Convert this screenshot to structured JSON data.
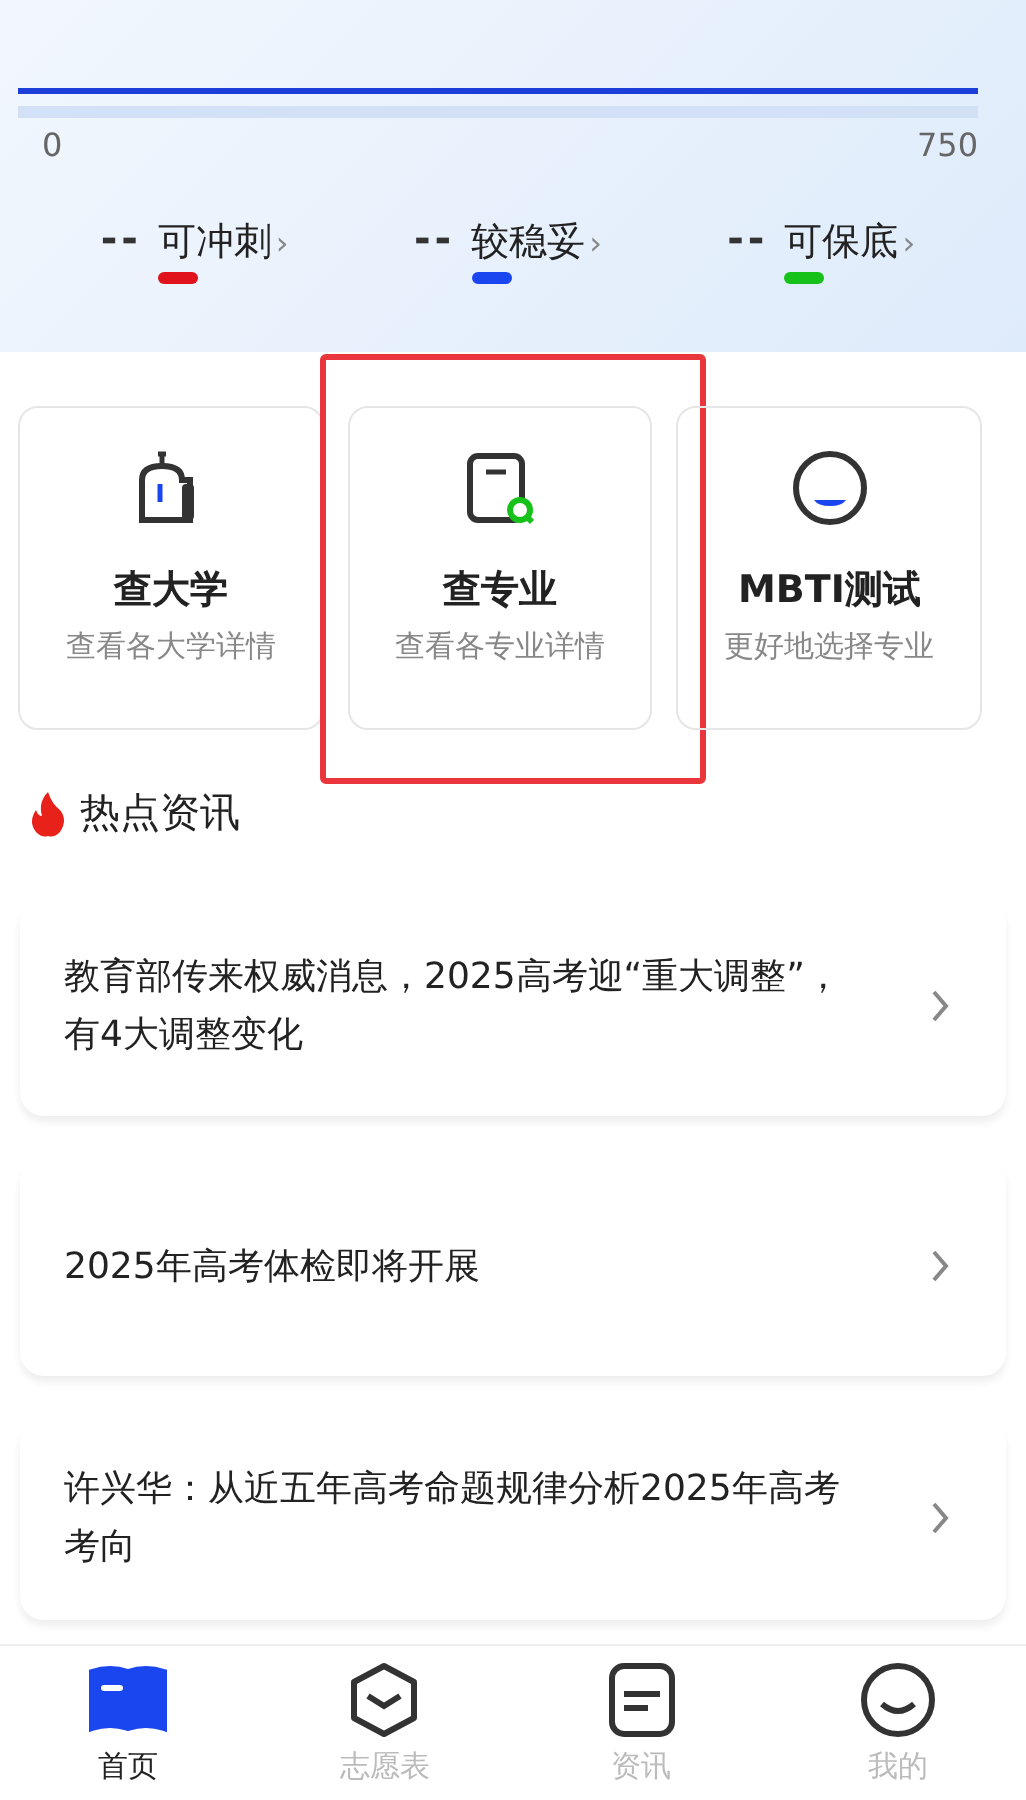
{
  "score_scale": {
    "min": "0",
    "max": "750"
  },
  "levels": [
    {
      "value": "--",
      "label": "可冲刺",
      "chevron": "›",
      "color": "#e0121c"
    },
    {
      "value": "--",
      "label": "较稳妥",
      "chevron": "›",
      "color": "#1a46f0"
    },
    {
      "value": "--",
      "label": "可保底",
      "chevron": "›",
      "color": "#16c21a"
    }
  ],
  "tools": [
    {
      "kind": "university",
      "title": "查大学",
      "subtitle": "查看各大学详情",
      "highlighted": false
    },
    {
      "kind": "major",
      "title": "查专业",
      "subtitle": "查看各专业详情",
      "highlighted": true
    },
    {
      "kind": "mbti",
      "title": "MBTI测试",
      "subtitle": "更好地选择专业",
      "highlighted": false
    }
  ],
  "news_section": {
    "title": "热点资讯"
  },
  "news": [
    {
      "text": "教育部传来权威消息，2025高考迎“重大调整”，有4大调整变化"
    },
    {
      "text": "2025年高考体检即将开展"
    },
    {
      "text": "许兴华：从近五年高考命题规律分析2025年高考考向"
    }
  ],
  "tab_bar": [
    {
      "kind": "home",
      "label": "首页",
      "selected": true
    },
    {
      "kind": "cap",
      "label": "志愿表",
      "selected": false
    },
    {
      "kind": "news",
      "label": "资讯",
      "selected": false
    },
    {
      "kind": "me",
      "label": "我的",
      "selected": false
    }
  ]
}
